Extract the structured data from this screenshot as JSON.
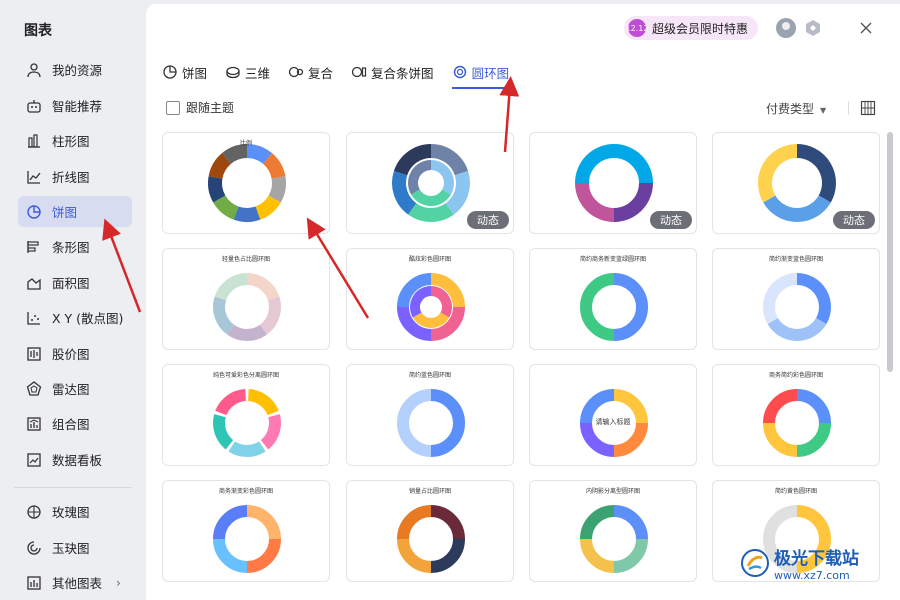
{
  "sidebar": {
    "title": "图表",
    "items": [
      {
        "label": "我的资源",
        "icon": "user-icon"
      },
      {
        "label": "智能推荐",
        "icon": "recommend-icon"
      },
      {
        "label": "柱形图",
        "icon": "bar-chart-icon"
      },
      {
        "label": "折线图",
        "icon": "line-chart-icon"
      },
      {
        "label": "饼图",
        "icon": "pie-chart-icon",
        "active": true
      },
      {
        "label": "条形图",
        "icon": "horizontal-bar-icon"
      },
      {
        "label": "面积图",
        "icon": "area-chart-icon"
      },
      {
        "label": "X Y (散点图)",
        "icon": "scatter-icon"
      },
      {
        "label": "股价图",
        "icon": "stock-chart-icon"
      },
      {
        "label": "雷达图",
        "icon": "radar-chart-icon"
      },
      {
        "label": "组合图",
        "icon": "combo-chart-icon"
      },
      {
        "label": "数据看板",
        "icon": "dashboard-icon"
      }
    ],
    "extra_items": [
      {
        "label": "玫瑰图",
        "icon": "rose-chart-icon"
      },
      {
        "label": "玉玦图",
        "icon": "jade-chart-icon"
      },
      {
        "label": "其他图表",
        "icon": "other-chart-icon"
      }
    ]
  },
  "header": {
    "promo_label": "超级会员限时特惠",
    "promo_badge": "12.12"
  },
  "tabs": [
    {
      "label": "饼图",
      "icon": "pie-icon"
    },
    {
      "label": "三维",
      "icon": "3d-pie-icon"
    },
    {
      "label": "复合",
      "icon": "compound-pie-icon"
    },
    {
      "label": "复合条饼图",
      "icon": "bar-of-pie-icon"
    },
    {
      "label": "圆环图",
      "icon": "donut-icon",
      "active": true
    }
  ],
  "toolbar": {
    "follow_theme_label": "跟随主题",
    "paid_type_label": "付费类型"
  },
  "cards": [
    {
      "title": "比例",
      "badge": ""
    },
    {
      "title": "",
      "badge": "动态"
    },
    {
      "title": "",
      "badge": "动态"
    },
    {
      "title": "",
      "badge": "动态"
    },
    {
      "title": "轻量色占比圆环图",
      "badge": ""
    },
    {
      "title": "酷炫彩色圆环图",
      "badge": ""
    },
    {
      "title": "简约商务新变蓝绿圆环图",
      "badge": ""
    },
    {
      "title": "简约渐变蓝色圆环图",
      "badge": ""
    },
    {
      "title": "纯色可爱彩色分离圆环图",
      "badge": ""
    },
    {
      "title": "简约蓝色圆环图",
      "badge": ""
    },
    {
      "title": "",
      "badge": ""
    },
    {
      "title": "商务简约彩色圆环图",
      "badge": ""
    },
    {
      "title": "商务渐变彩色圆环图",
      "badge": ""
    },
    {
      "title": "销量占比圆环图",
      "badge": ""
    },
    {
      "title": "内阴影分离型圆环图",
      "badge": ""
    },
    {
      "title": "简约黄色圆环图",
      "badge": ""
    }
  ],
  "center_label": "请输入标题",
  "watermark": {
    "name": "极光下载站",
    "url": "www.xz7.com"
  },
  "colors": {
    "accent": "#3d5bd9",
    "active_bg": "#d7dcf0",
    "arrow": "#d62828"
  }
}
